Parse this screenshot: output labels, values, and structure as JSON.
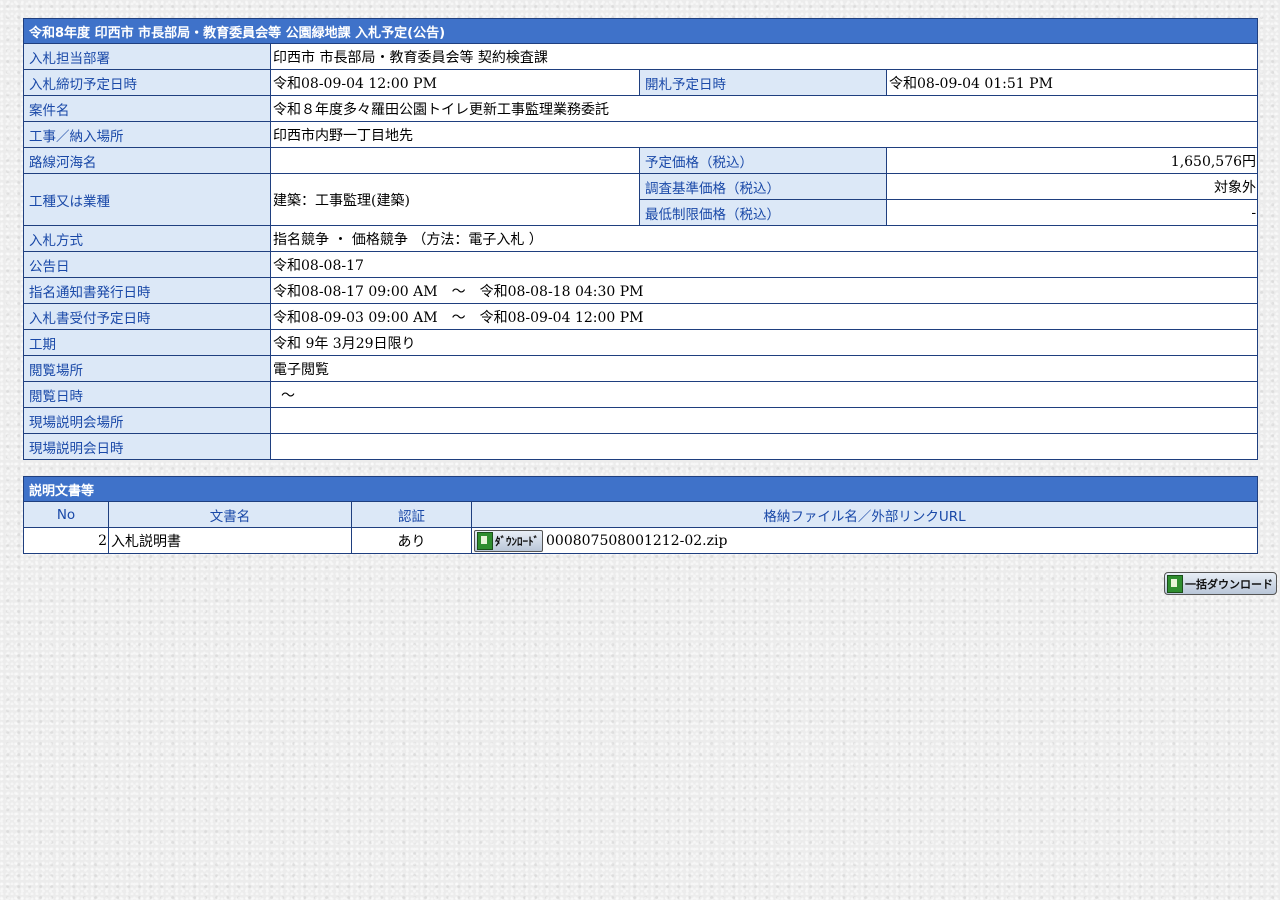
{
  "header": {
    "title": "令和8年度 印西市 市長部局・教育委員会等 公園緑地課 入札予定(公告)"
  },
  "rows": {
    "dept": {
      "label": "入札担当部署",
      "value": "印西市 市長部局・教育委員会等 契約検査課"
    },
    "deadline": {
      "label": "入札締切予定日時",
      "value": "令和08-09-04 12:00 PM"
    },
    "opening": {
      "label": "開札予定日時",
      "value": "令和08-09-04 01:51 PM"
    },
    "case": {
      "label": "案件名",
      "value": "令和８年度多々羅田公園トイレ更新工事監理業務委託"
    },
    "place": {
      "label": "工事／納入場所",
      "value": "印西市内野一丁目地先"
    },
    "route": {
      "label": "路線河海名",
      "value": ""
    },
    "planned_price": {
      "label": "予定価格（税込）",
      "value": "1,650,576円"
    },
    "work_type": {
      "label": "工種又は業種",
      "value": "建築：工事監理(建築)"
    },
    "survey_price": {
      "label": "調査基準価格（税込）",
      "value": "対象外"
    },
    "min_price": {
      "label": "最低制限価格（税込）",
      "value": "-"
    },
    "method": {
      "label": "入札方式",
      "value": "指名競争 ・ 価格競争 （方法：電子入札 ）"
    },
    "notice_date": {
      "label": "公告日",
      "value": "令和08-08-17"
    },
    "nomination": {
      "label": "指名通知書発行日時",
      "value": "令和08-08-17 09:00 AM　～　令和08-08-18 04:30 PM"
    },
    "bid_accept": {
      "label": "入札書受付予定日時",
      "value": "令和08-09-03 09:00 AM　～　令和08-09-04 12:00 PM"
    },
    "period": {
      "label": "工期",
      "value": "令和 9年 3月29日限り"
    },
    "view_place": {
      "label": "閲覧場所",
      "value": "電子閲覧"
    },
    "view_time": {
      "label": "閲覧日時",
      "value": "～"
    },
    "brief_place": {
      "label": "現場説明会場所",
      "value": ""
    },
    "brief_time": {
      "label": "現場説明会日時",
      "value": ""
    }
  },
  "docs": {
    "title": "説明文書等",
    "columns": [
      "No",
      "文書名",
      "認証",
      "格納ファイル名／外部リンクURL"
    ],
    "items": [
      {
        "no": "2",
        "name": "入札説明書",
        "auth": "あり",
        "download_label": "ﾀﾞｳﾝﾛｰﾄﾞ",
        "file": "000807508001212-02.zip"
      }
    ]
  },
  "bulk_download_label": "一括ダウンロード",
  "colors": {
    "header_bg": "#3f72c9",
    "label_bg": "#dce8f7",
    "label_text": "#1a49a8",
    "border": "#1f3f7f"
  },
  "icons": [
    "download-file-icon"
  ]
}
